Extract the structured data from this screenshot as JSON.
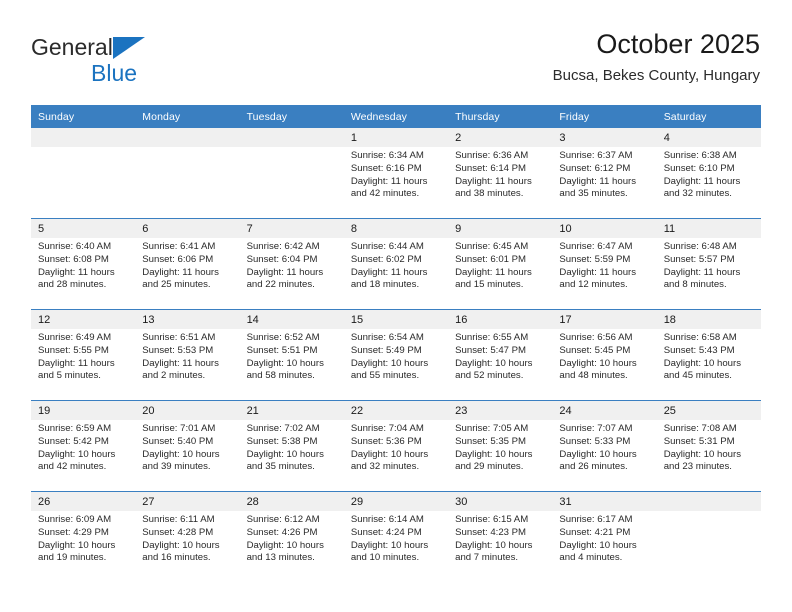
{
  "brand": {
    "name_top": "General",
    "name_bottom": "Blue",
    "triangle_color": "#1b73c0"
  },
  "header": {
    "title": "October 2025",
    "subtitle": "Bucsa, Bekes County, Hungary"
  },
  "colors": {
    "header_blue": "#3a7fc1",
    "daynum_band": "#f0f0f0",
    "text": "#1a1a1a"
  },
  "weekdays": [
    "Sunday",
    "Monday",
    "Tuesday",
    "Wednesday",
    "Thursday",
    "Friday",
    "Saturday"
  ],
  "weeks": [
    [
      {
        "day": "",
        "empty": true
      },
      {
        "day": "",
        "empty": true
      },
      {
        "day": "",
        "empty": true
      },
      {
        "day": "1",
        "sunrise": "Sunrise: 6:34 AM",
        "sunset": "Sunset: 6:16 PM",
        "daylight1": "Daylight: 11 hours",
        "daylight2": "and 42 minutes."
      },
      {
        "day": "2",
        "sunrise": "Sunrise: 6:36 AM",
        "sunset": "Sunset: 6:14 PM",
        "daylight1": "Daylight: 11 hours",
        "daylight2": "and 38 minutes."
      },
      {
        "day": "3",
        "sunrise": "Sunrise: 6:37 AM",
        "sunset": "Sunset: 6:12 PM",
        "daylight1": "Daylight: 11 hours",
        "daylight2": "and 35 minutes."
      },
      {
        "day": "4",
        "sunrise": "Sunrise: 6:38 AM",
        "sunset": "Sunset: 6:10 PM",
        "daylight1": "Daylight: 11 hours",
        "daylight2": "and 32 minutes."
      }
    ],
    [
      {
        "day": "5",
        "sunrise": "Sunrise: 6:40 AM",
        "sunset": "Sunset: 6:08 PM",
        "daylight1": "Daylight: 11 hours",
        "daylight2": "and 28 minutes."
      },
      {
        "day": "6",
        "sunrise": "Sunrise: 6:41 AM",
        "sunset": "Sunset: 6:06 PM",
        "daylight1": "Daylight: 11 hours",
        "daylight2": "and 25 minutes."
      },
      {
        "day": "7",
        "sunrise": "Sunrise: 6:42 AM",
        "sunset": "Sunset: 6:04 PM",
        "daylight1": "Daylight: 11 hours",
        "daylight2": "and 22 minutes."
      },
      {
        "day": "8",
        "sunrise": "Sunrise: 6:44 AM",
        "sunset": "Sunset: 6:02 PM",
        "daylight1": "Daylight: 11 hours",
        "daylight2": "and 18 minutes."
      },
      {
        "day": "9",
        "sunrise": "Sunrise: 6:45 AM",
        "sunset": "Sunset: 6:01 PM",
        "daylight1": "Daylight: 11 hours",
        "daylight2": "and 15 minutes."
      },
      {
        "day": "10",
        "sunrise": "Sunrise: 6:47 AM",
        "sunset": "Sunset: 5:59 PM",
        "daylight1": "Daylight: 11 hours",
        "daylight2": "and 12 minutes."
      },
      {
        "day": "11",
        "sunrise": "Sunrise: 6:48 AM",
        "sunset": "Sunset: 5:57 PM",
        "daylight1": "Daylight: 11 hours",
        "daylight2": "and 8 minutes."
      }
    ],
    [
      {
        "day": "12",
        "sunrise": "Sunrise: 6:49 AM",
        "sunset": "Sunset: 5:55 PM",
        "daylight1": "Daylight: 11 hours",
        "daylight2": "and 5 minutes."
      },
      {
        "day": "13",
        "sunrise": "Sunrise: 6:51 AM",
        "sunset": "Sunset: 5:53 PM",
        "daylight1": "Daylight: 11 hours",
        "daylight2": "and 2 minutes."
      },
      {
        "day": "14",
        "sunrise": "Sunrise: 6:52 AM",
        "sunset": "Sunset: 5:51 PM",
        "daylight1": "Daylight: 10 hours",
        "daylight2": "and 58 minutes."
      },
      {
        "day": "15",
        "sunrise": "Sunrise: 6:54 AM",
        "sunset": "Sunset: 5:49 PM",
        "daylight1": "Daylight: 10 hours",
        "daylight2": "and 55 minutes."
      },
      {
        "day": "16",
        "sunrise": "Sunrise: 6:55 AM",
        "sunset": "Sunset: 5:47 PM",
        "daylight1": "Daylight: 10 hours",
        "daylight2": "and 52 minutes."
      },
      {
        "day": "17",
        "sunrise": "Sunrise: 6:56 AM",
        "sunset": "Sunset: 5:45 PM",
        "daylight1": "Daylight: 10 hours",
        "daylight2": "and 48 minutes."
      },
      {
        "day": "18",
        "sunrise": "Sunrise: 6:58 AM",
        "sunset": "Sunset: 5:43 PM",
        "daylight1": "Daylight: 10 hours",
        "daylight2": "and 45 minutes."
      }
    ],
    [
      {
        "day": "19",
        "sunrise": "Sunrise: 6:59 AM",
        "sunset": "Sunset: 5:42 PM",
        "daylight1": "Daylight: 10 hours",
        "daylight2": "and 42 minutes."
      },
      {
        "day": "20",
        "sunrise": "Sunrise: 7:01 AM",
        "sunset": "Sunset: 5:40 PM",
        "daylight1": "Daylight: 10 hours",
        "daylight2": "and 39 minutes."
      },
      {
        "day": "21",
        "sunrise": "Sunrise: 7:02 AM",
        "sunset": "Sunset: 5:38 PM",
        "daylight1": "Daylight: 10 hours",
        "daylight2": "and 35 minutes."
      },
      {
        "day": "22",
        "sunrise": "Sunrise: 7:04 AM",
        "sunset": "Sunset: 5:36 PM",
        "daylight1": "Daylight: 10 hours",
        "daylight2": "and 32 minutes."
      },
      {
        "day": "23",
        "sunrise": "Sunrise: 7:05 AM",
        "sunset": "Sunset: 5:35 PM",
        "daylight1": "Daylight: 10 hours",
        "daylight2": "and 29 minutes."
      },
      {
        "day": "24",
        "sunrise": "Sunrise: 7:07 AM",
        "sunset": "Sunset: 5:33 PM",
        "daylight1": "Daylight: 10 hours",
        "daylight2": "and 26 minutes."
      },
      {
        "day": "25",
        "sunrise": "Sunrise: 7:08 AM",
        "sunset": "Sunset: 5:31 PM",
        "daylight1": "Daylight: 10 hours",
        "daylight2": "and 23 minutes."
      }
    ],
    [
      {
        "day": "26",
        "sunrise": "Sunrise: 6:09 AM",
        "sunset": "Sunset: 4:29 PM",
        "daylight1": "Daylight: 10 hours",
        "daylight2": "and 19 minutes."
      },
      {
        "day": "27",
        "sunrise": "Sunrise: 6:11 AM",
        "sunset": "Sunset: 4:28 PM",
        "daylight1": "Daylight: 10 hours",
        "daylight2": "and 16 minutes."
      },
      {
        "day": "28",
        "sunrise": "Sunrise: 6:12 AM",
        "sunset": "Sunset: 4:26 PM",
        "daylight1": "Daylight: 10 hours",
        "daylight2": "and 13 minutes."
      },
      {
        "day": "29",
        "sunrise": "Sunrise: 6:14 AM",
        "sunset": "Sunset: 4:24 PM",
        "daylight1": "Daylight: 10 hours",
        "daylight2": "and 10 minutes."
      },
      {
        "day": "30",
        "sunrise": "Sunrise: 6:15 AM",
        "sunset": "Sunset: 4:23 PM",
        "daylight1": "Daylight: 10 hours",
        "daylight2": "and 7 minutes."
      },
      {
        "day": "31",
        "sunrise": "Sunrise: 6:17 AM",
        "sunset": "Sunset: 4:21 PM",
        "daylight1": "Daylight: 10 hours",
        "daylight2": "and 4 minutes."
      },
      {
        "day": "",
        "empty": true
      }
    ]
  ]
}
